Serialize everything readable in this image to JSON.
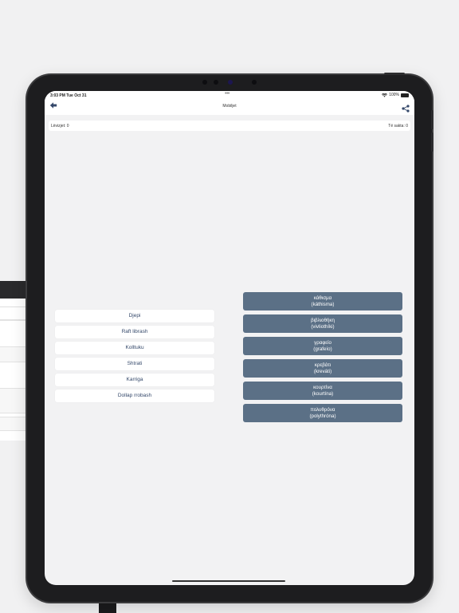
{
  "status": {
    "time": "3:03 PM  Tue Oct 31",
    "dots": "•••",
    "battery": "100%"
  },
  "nav": {
    "title": "Mobiljet"
  },
  "score": {
    "left": "Lëvizjet: 0",
    "right": "Të sakta: 0"
  },
  "words": [
    "Djepi",
    "Raft librash",
    "Kolltuku",
    "Shtrati",
    "Karriga",
    "Dollap rrobash"
  ],
  "translations": [
    {
      "greek": "κάθισμα",
      "latin": "(káthisma)"
    },
    {
      "greek": "βιβλιοθήκη",
      "latin": "(vivliothíki)"
    },
    {
      "greek": "γραφείο",
      "latin": "(grafeío)"
    },
    {
      "greek": "κρεβάτι",
      "latin": "(kreváti)"
    },
    {
      "greek": "κουρτίνα",
      "latin": "(kourtína)"
    },
    {
      "greek": "πολυθρόνα",
      "latin": "(polythróna)"
    }
  ],
  "colors": {
    "accent": "#34486a",
    "tile": "#5b7086"
  }
}
